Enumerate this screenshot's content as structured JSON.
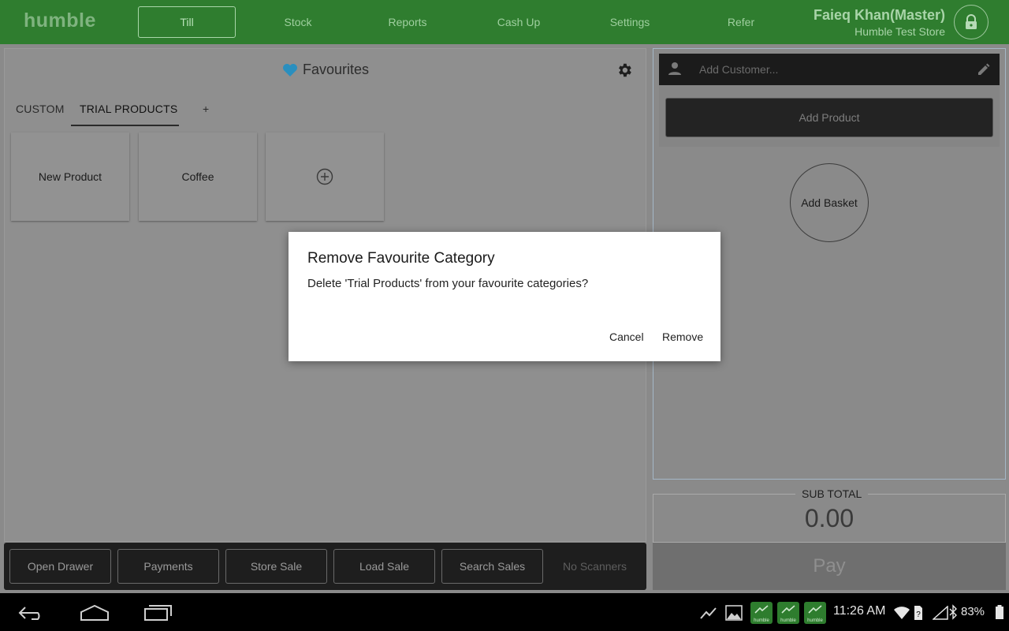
{
  "topbar": {
    "logo": "humble",
    "nav": [
      "Till",
      "Stock",
      "Reports",
      "Cash Up",
      "Settings",
      "Refer"
    ],
    "active_nav": "Till",
    "user_name": "Faieq Khan(Master)",
    "store_name": "Humble Test Store"
  },
  "favourites": {
    "title": "Favourites",
    "tabs": [
      "CUSTOM",
      "TRIAL PRODUCTS",
      "+"
    ],
    "active_tab": "TRIAL PRODUCTS",
    "tiles": [
      "New Product",
      "Coffee"
    ]
  },
  "bottom_bar": {
    "buttons": [
      "Open Drawer",
      "Payments",
      "Store Sale",
      "Load Sale",
      "Search Sales"
    ],
    "scanner_status": "No Scanners"
  },
  "cart": {
    "customer_placeholder": "Add Customer...",
    "add_product": "Add Product",
    "add_basket": "Add Basket",
    "subtotal_label": "SUB TOTAL",
    "subtotal_value": "0.00",
    "pay_label": "Pay"
  },
  "dialog": {
    "title": "Remove Favourite Category",
    "message": "Delete 'Trial Products' from your favourite categories?",
    "cancel": "Cancel",
    "remove": "Remove"
  },
  "statusbar": {
    "time": "11:26 AM",
    "battery": "83%",
    "app_chip_label": "humble"
  },
  "colors": {
    "brand_green": "#2f7d2f",
    "heart_blue": "#29a3d6"
  }
}
